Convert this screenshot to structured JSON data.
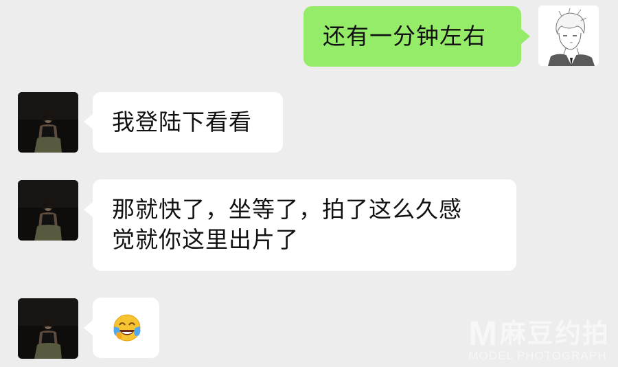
{
  "messages": [
    {
      "sender": "me",
      "text": "还有一分钟左右"
    },
    {
      "sender": "other",
      "text": "我登陆下看看"
    },
    {
      "sender": "other",
      "text": "那就快了，坐等了，拍了这么久感\n觉就你这里出片了"
    },
    {
      "sender": "other",
      "emoji": "face-with-tears-of-joy-icon"
    }
  ],
  "watermark": {
    "logo": "M",
    "chinese": "麻豆约拍",
    "english": "MODEL PHOTOGRAPH"
  },
  "colors": {
    "background": "#ededed",
    "incoming_bubble": "#ffffff",
    "outgoing_bubble": "#95ec69"
  }
}
